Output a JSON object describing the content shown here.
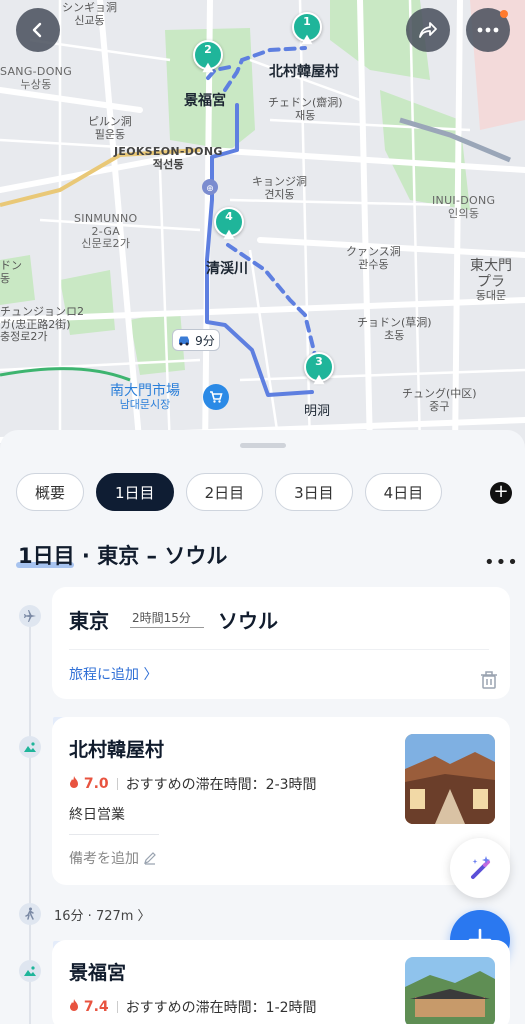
{
  "map": {
    "labels": {
      "sinsa_jp": "シンギョ洞",
      "sinsa_kr": "신교동",
      "sangdong_en": "SANG-DONG",
      "sangdong_kr": "누상동",
      "bukchon": "北村韓屋村",
      "gyeongbok": "景福宮",
      "pildong_jp": "ピルン洞",
      "pildong_kr": "필운동",
      "jaedong_jp": "チェドン(齋洞)",
      "jaedong_kr": "재동",
      "jeokseon_en": "JEOKSEON-DONG",
      "jeokseon_kr": "적선동",
      "gyeonji_jp": "キョンジ洞",
      "gyeonji_kr": "견지동",
      "inui_en": "INUI-DONG",
      "inui_kr": "인의동",
      "sinmunno_en": "SINMUNNO",
      "sinmunno_2": "2-GA",
      "sinmunno_kr": "신문로2가",
      "cheonggye": "清渓川",
      "gwansu_jp": "クァンス洞",
      "gwansu_kr": "관수동",
      "dongdaemun_jp": "東大門",
      "dongdaemun_jp2": "プラ",
      "dongdaemun_kr": "동대문",
      "chungjeongno_jp": "チュンジョンロ2",
      "chungjeongno_jp2": "ガ(忠正路2街)",
      "chungjeongno_kr": "충정로2가",
      "chodong_jp": "チョドン(草洞)",
      "chodong_kr": "초동",
      "namdaemun_jp": "南大門市場",
      "namdaemun_kr": "남대문시장",
      "myeongdong": "明洞",
      "junggu_jp": "チュング(中区)",
      "junggu_kr": "중구",
      "edge_left": "ドン",
      "edge_left2": "동"
    },
    "car_time": "9分",
    "pins": [
      "1",
      "2",
      "3",
      "4"
    ]
  },
  "tabs": [
    "概要",
    "1日目",
    "2日目",
    "3日目",
    "4日目"
  ],
  "day": {
    "title": "1日目 · 東京 – ソウル",
    "flight": {
      "from": "東京",
      "duration": "2時間15分",
      "to": "ソウル",
      "add_link": "旅程に追加 〉"
    },
    "places": [
      {
        "num": "1",
        "title": "北村韓屋村",
        "rating": "7.0",
        "stay": "おすすめの滞在時間：2-3時間",
        "hours": "終日営業",
        "note": "備考を追加"
      },
      {
        "num": "2",
        "title": "景福宮",
        "rating": "7.4",
        "stay": "おすすめの滞在時間：1-2時間"
      }
    ],
    "walk": "16分 · 727m 〉"
  }
}
